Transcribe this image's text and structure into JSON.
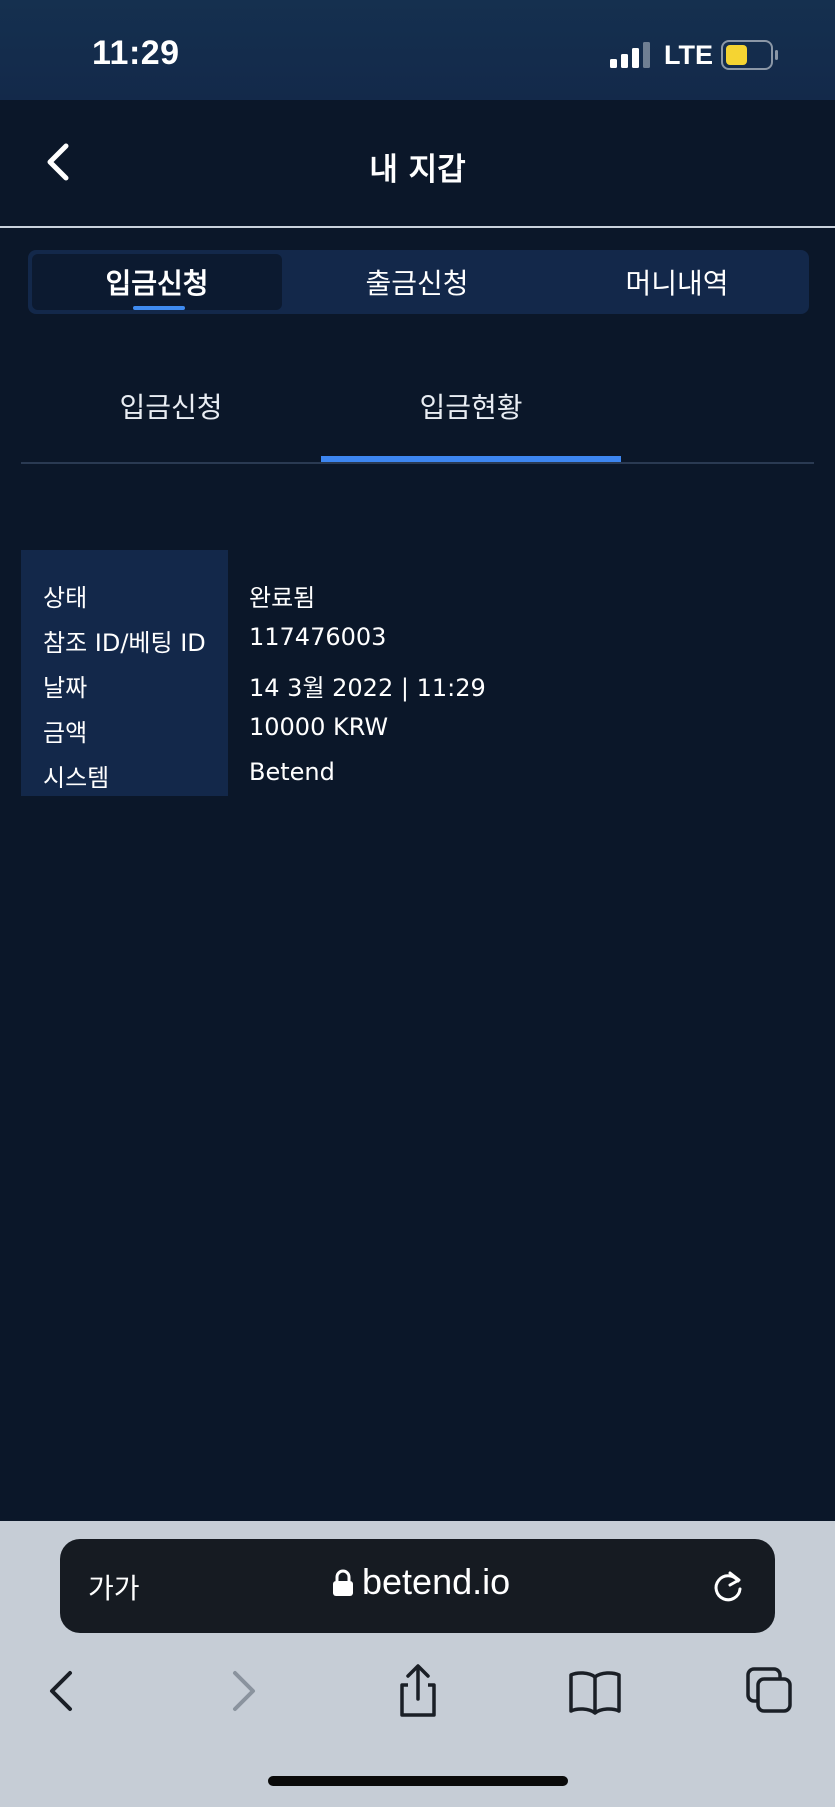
{
  "status_bar": {
    "time": "11:29",
    "network": "LTE",
    "battery_color": "#f5d432"
  },
  "header": {
    "title": "내 지갑",
    "back_icon": "chevron-left-icon"
  },
  "main_tabs": [
    {
      "label": "입금신청",
      "active": true
    },
    {
      "label": "출금신청",
      "active": false
    },
    {
      "label": "머니내역",
      "active": false
    }
  ],
  "sub_tabs": [
    {
      "label": "입금신청",
      "active": false
    },
    {
      "label": "입금현황",
      "active": true
    }
  ],
  "details": [
    {
      "label": "상태",
      "value": "완료됨"
    },
    {
      "label": "참조 ID/베팅 ID",
      "value": "117476003"
    },
    {
      "label": "날짜",
      "value": "14 3월 2022 | 11:29"
    },
    {
      "label": "금액",
      "value": "10000 KRW"
    },
    {
      "label": "시스템",
      "value": "Betend"
    }
  ],
  "browser": {
    "reader_label": "가가",
    "url": "betend.io",
    "toolbar_icons": [
      "back-icon",
      "forward-icon",
      "share-icon",
      "bookmarks-icon",
      "tabs-icon"
    ]
  },
  "colors": {
    "background": "#0b1729",
    "panel": "#13284a",
    "accent": "#3d86f0"
  }
}
